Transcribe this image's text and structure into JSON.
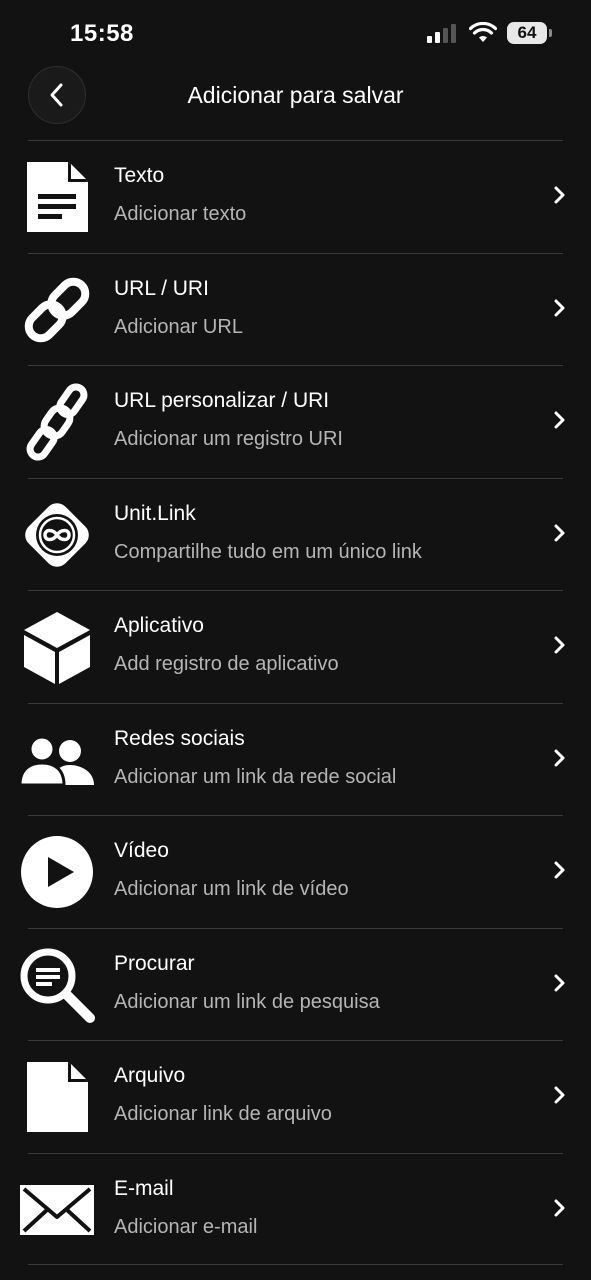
{
  "status_bar": {
    "time": "15:58",
    "battery": "64"
  },
  "header": {
    "title": "Adicionar para salvar",
    "back_icon": "chevron-left-icon"
  },
  "colors": {
    "background": "#121212",
    "text": "#ffffff",
    "subtext": "#b5b5b5",
    "divider": "#3a3a3a"
  },
  "items": [
    {
      "title": "Texto",
      "subtitle": "Adicionar texto",
      "icon": "document-text-icon"
    },
    {
      "title": "URL / URI",
      "subtitle": "Adicionar URL",
      "icon": "link-icon"
    },
    {
      "title": "URL personalizar / URI",
      "subtitle": "Adicionar um registro URI",
      "icon": "broken-link-icon"
    },
    {
      "title": "Unit.Link",
      "subtitle": "Compartilhe tudo em um único link",
      "icon": "infinity-badge-icon"
    },
    {
      "title": "Aplicativo",
      "subtitle": "Add registro de aplicativo",
      "icon": "cube-icon"
    },
    {
      "title": "Redes sociais",
      "subtitle": "Adicionar um link da rede social",
      "icon": "users-icon"
    },
    {
      "title": "Vídeo",
      "subtitle": "Adicionar um link de vídeo",
      "icon": "play-circle-icon"
    },
    {
      "title": "Procurar",
      "subtitle": "Adicionar um link de pesquisa",
      "icon": "search-icon"
    },
    {
      "title": "Arquivo",
      "subtitle": "Adicionar link de arquivo",
      "icon": "file-icon"
    },
    {
      "title": "E-mail",
      "subtitle": "Adicionar e-mail",
      "icon": "envelope-icon"
    }
  ]
}
